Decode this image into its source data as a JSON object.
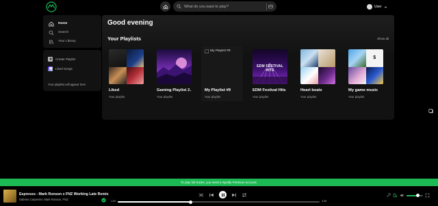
{
  "topbar": {
    "search_placeholder": "What do you want to play?",
    "user_name": "User"
  },
  "sidebar": {
    "nav": [
      {
        "label": "Home",
        "icon": "home-icon",
        "active": true
      },
      {
        "label": "Search",
        "icon": "search-icon",
        "active": false
      },
      {
        "label": "Your Library",
        "icon": "library-icon",
        "active": false
      }
    ],
    "library": {
      "create_label": "Create Playlist",
      "liked_label": "Liked Songs",
      "empty_text": "Your playlists will appear here"
    }
  },
  "main": {
    "greeting": "Good evening",
    "section_title": "Your Playlists",
    "show_all": "Show all",
    "playlists": [
      {
        "title": "Liked",
        "subtitle": "Your playlist",
        "cover": "collage"
      },
      {
        "title": "Gaming Playlist 2…",
        "subtitle": "Your playlist",
        "cover": "neon-landscape"
      },
      {
        "title": "My Playlist #9",
        "subtitle": "Your playlist",
        "cover": "broken",
        "alt": "My Playlist #9"
      },
      {
        "title": "EDM Festival Hits",
        "subtitle": "Your playlist",
        "cover": "edm",
        "cover_text": "EDM FESTIVAL HITS"
      },
      {
        "title": "Heart beats",
        "subtitle": "Your playlist",
        "cover": "collage"
      },
      {
        "title": "My game music",
        "subtitle": "Your playlist",
        "cover": "collage"
      }
    ]
  },
  "banner": {
    "text": "To play full tracks, you need a Spotify Premium account."
  },
  "player": {
    "track_title": "Espresso - Mark Ronson x FNZ Working Late Remix",
    "artists": "Sabrina Carpenter, Mark Ronson, FNZ",
    "time_current": "1:00",
    "time_total": "3:38",
    "progress_fraction": 0.36,
    "volume_fraction": 0.7
  },
  "colors": {
    "accent": "#1db954",
    "panel": "#121212",
    "background": "#000000"
  }
}
